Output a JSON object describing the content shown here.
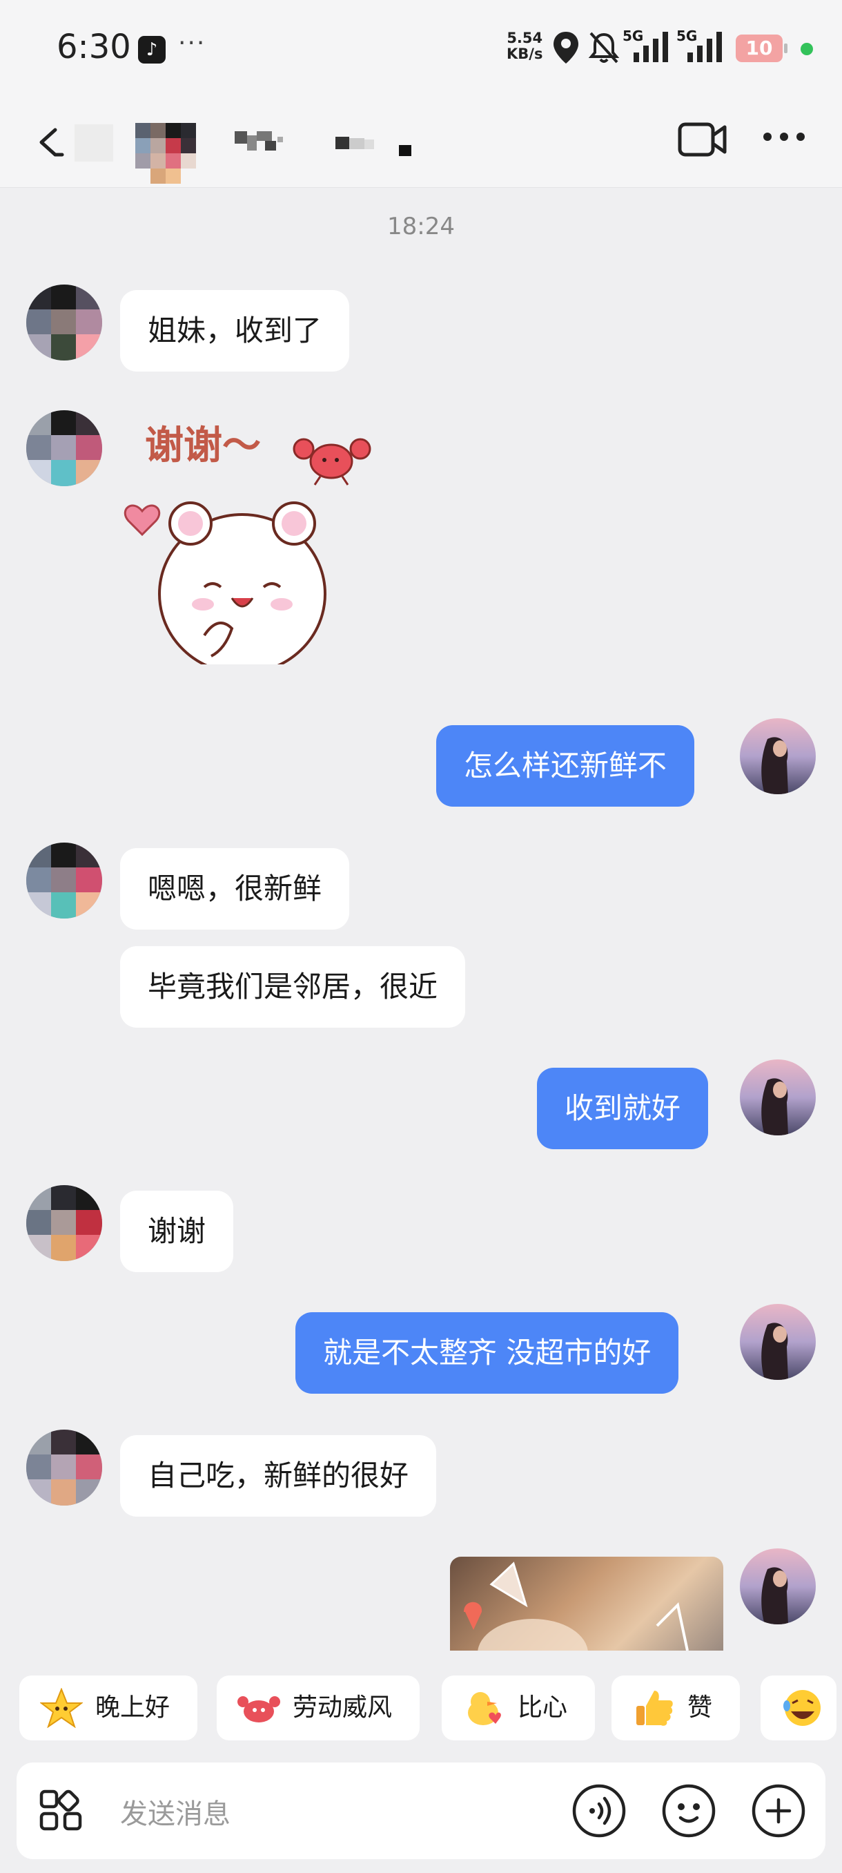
{
  "status_bar": {
    "time": "6:30",
    "overflow": "···",
    "net_speed_value": "5.54",
    "net_speed_unit": "KB/s",
    "signal_1_label": "5G",
    "signal_2_label": "5G",
    "battery": "10",
    "icons": [
      "tiktok-icon",
      "location-icon",
      "bell-muted-icon",
      "signal-icon",
      "signal-icon",
      "battery-icon"
    ]
  },
  "header": {
    "icons": [
      "back-icon",
      "video-call-icon",
      "more-icon"
    ]
  },
  "chat": {
    "timestamp": "18:24",
    "messages": [
      {
        "from": "them",
        "text": "姐妹，收到了"
      },
      {
        "from": "them",
        "type": "sticker",
        "text": "谢谢～"
      },
      {
        "from": "me",
        "text": "怎么样还新鲜不"
      },
      {
        "from": "them",
        "text": "嗯嗯，很新鲜"
      },
      {
        "from": "them",
        "text": "毕竟我们是邻居，很近"
      },
      {
        "from": "me",
        "text": "收到就好"
      },
      {
        "from": "them",
        "text": "谢谢"
      },
      {
        "from": "me",
        "text": "就是不太整齐 没超市的好"
      },
      {
        "from": "them",
        "text": "自己吃，新鲜的很好"
      },
      {
        "from": "me",
        "type": "image"
      }
    ]
  },
  "quick_replies": [
    {
      "label": "晚上好",
      "icon": "star-emoji-icon"
    },
    {
      "label": "劳动威风",
      "icon": "crab-emoji-icon"
    },
    {
      "label": "比心",
      "icon": "duck-emoji-icon"
    },
    {
      "label": "赞",
      "icon": "thumbs-up-emoji-icon"
    },
    {
      "label": "",
      "icon": "laughing-emoji-icon"
    }
  ],
  "composer": {
    "placeholder": "发送消息",
    "icons": [
      "apps-icon",
      "voice-icon",
      "emoji-icon",
      "plus-icon"
    ]
  },
  "colors": {
    "outgoing_bubble": "#4d86f7",
    "incoming_bubble": "#ffffff",
    "background": "#efeff1"
  }
}
